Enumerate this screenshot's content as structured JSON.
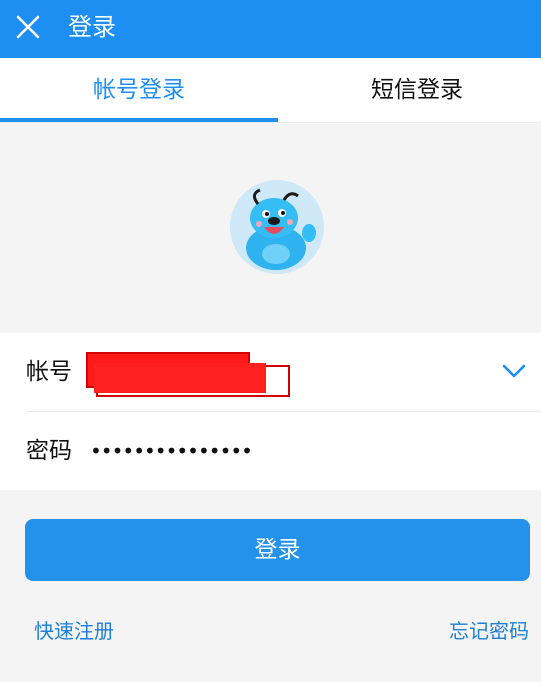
{
  "header": {
    "title": "登录",
    "close_icon": "close-icon"
  },
  "tabs": [
    {
      "label": "帐号登录",
      "active": true
    },
    {
      "label": "短信登录",
      "active": false
    }
  ],
  "avatar": {
    "description_icon": "cartoon-dog-avatar"
  },
  "form": {
    "account_label": "帐号",
    "account_value_redacted": true,
    "password_label": "密码",
    "password_value": "•••••••••••••••"
  },
  "login_button": {
    "label": "登录"
  },
  "links": {
    "register": "快速注册",
    "forgot": "忘记密码"
  },
  "colors": {
    "primary": "#1e8ff2",
    "button": "#2492ea",
    "link": "#1e7fd6"
  }
}
